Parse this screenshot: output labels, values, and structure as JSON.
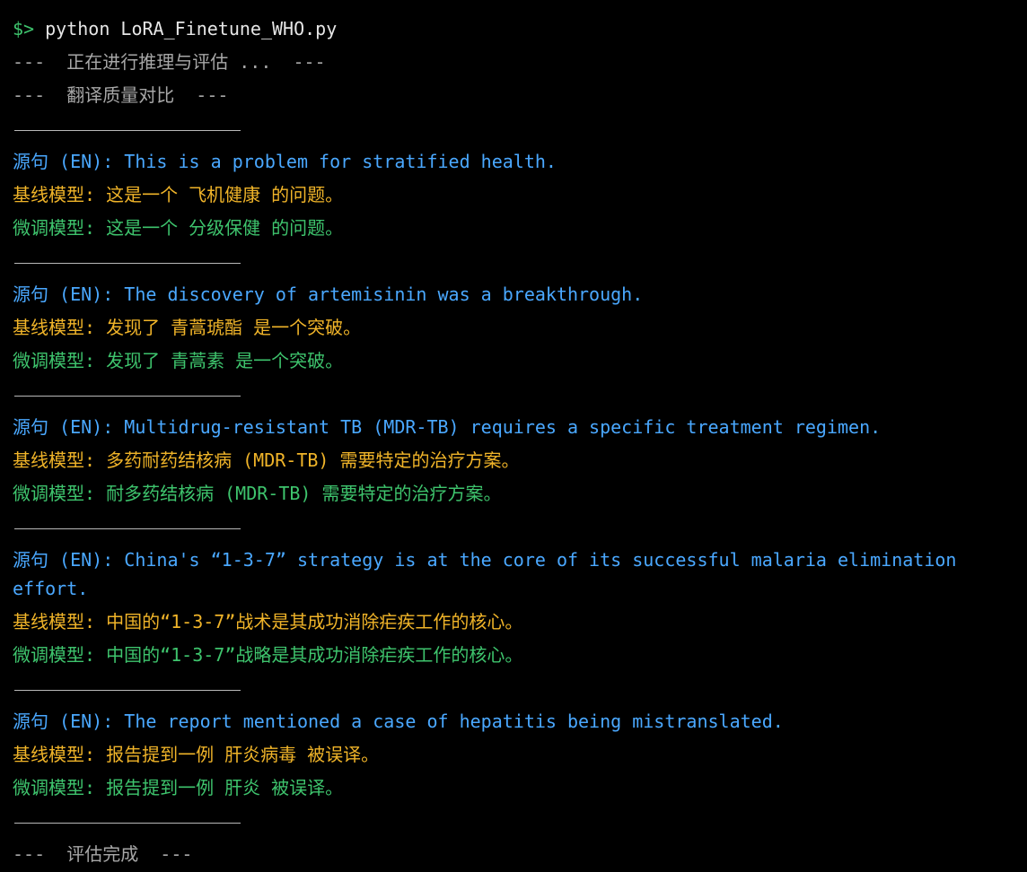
{
  "terminal": {
    "prompt_symbol": "$>",
    "command": "python LoRA_Finetune_WHO.py",
    "status_start": "---  正在进行推理与评估 ...  ---",
    "header": "---  翻译质量对比  ---",
    "footer": "---  评估完成  ---"
  },
  "labels": {
    "source": "源句 (EN): ",
    "baseline": "基线模型: ",
    "finetuned": "微调模型: "
  },
  "comparisons": [
    {
      "source": "This is a problem for stratified health.",
      "baseline": "这是一个 飞机健康 的问题。",
      "finetuned": "这是一个 分级保健 的问题。"
    },
    {
      "source": "The discovery of artemisinin was a breakthrough.",
      "baseline": "发现了 青蒿琥酯 是一个突破。",
      "finetuned": "发现了 青蒿素 是一个突破。"
    },
    {
      "source": "Multidrug-resistant TB (MDR-TB) requires a specific treatment regimen.",
      "baseline": "多药耐药结核病 (MDR-TB) 需要特定的治疗方案。",
      "finetuned": "耐多药结核病 (MDR-TB) 需要特定的治疗方案。"
    },
    {
      "source": "China's “1-3-7” strategy is at the core of its successful malaria elimination effort.",
      "baseline": "中国的“1-3-7”战术是其成功消除疟疾工作的核心。",
      "finetuned": "中国的“1-3-7”战略是其成功消除疟疾工作的核心。"
    },
    {
      "source": "The report mentioned a case of hepatitis being mistranslated.",
      "baseline": "报告提到一例 肝炎病毒 被误译。",
      "finetuned": "报告提到一例 肝炎 被误译。"
    }
  ]
}
